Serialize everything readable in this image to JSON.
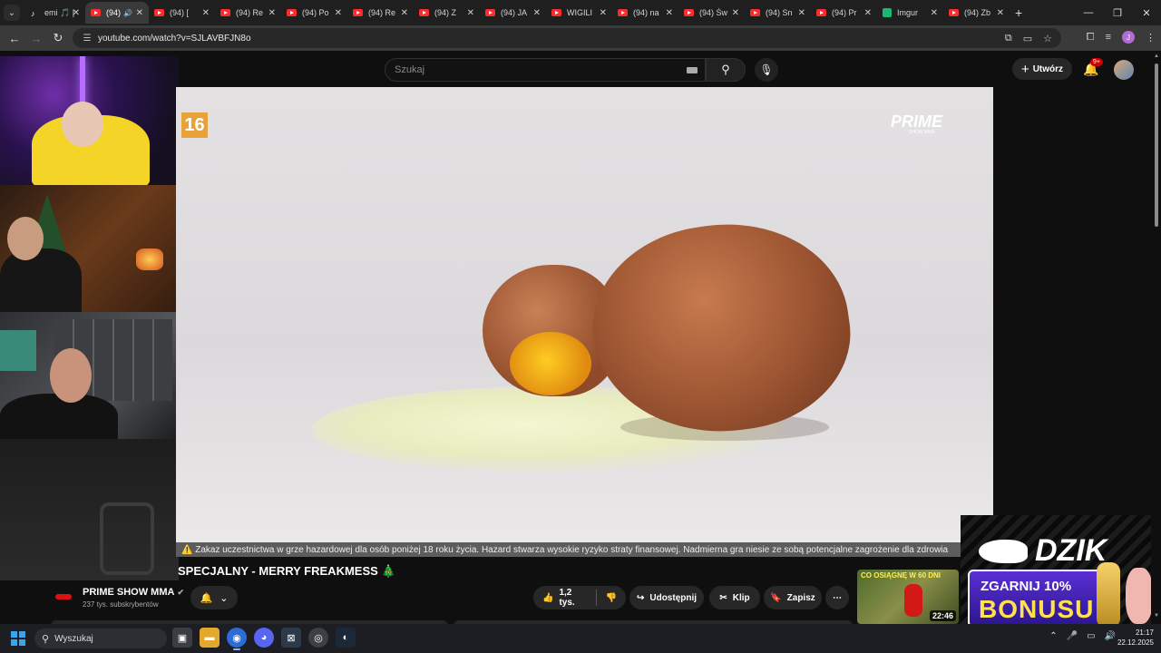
{
  "browser": {
    "tabs": [
      {
        "title": "emi 🎵 | ",
        "icon": "tiktok-icon",
        "active": false
      },
      {
        "title": "(94)",
        "icon": "youtube-icon",
        "active": true
      },
      {
        "title": "(94) [",
        "icon": "youtube-icon",
        "active": false
      },
      {
        "title": "(94) Re",
        "icon": "youtube-icon",
        "active": false
      },
      {
        "title": "(94) Po",
        "icon": "youtube-icon",
        "active": false
      },
      {
        "title": "(94) Re",
        "icon": "youtube-icon",
        "active": false
      },
      {
        "title": "(94) Z",
        "icon": "youtube-icon",
        "active": false
      },
      {
        "title": "(94) JA",
        "icon": "youtube-icon",
        "active": false
      },
      {
        "title": "WIGILI",
        "icon": "youtube-icon",
        "active": false
      },
      {
        "title": "(94) na",
        "icon": "youtube-icon",
        "active": false
      },
      {
        "title": "(94) Św",
        "icon": "youtube-icon",
        "active": false
      },
      {
        "title": "(94) Sn",
        "icon": "youtube-icon",
        "active": false
      },
      {
        "title": "(94) Pr",
        "icon": "youtube-icon",
        "active": false
      },
      {
        "title": "Imgur",
        "icon": "imgur-icon",
        "active": false
      },
      {
        "title": "(94) Zb",
        "icon": "youtube-icon",
        "active": false
      }
    ],
    "url": "youtube.com/watch?v=SJLAVBFJN8o"
  },
  "youtube": {
    "search_placeholder": "Szukaj",
    "create_label": "Utwórz",
    "notif_count": "9+",
    "video_title": "SPECJALNY - MERRY FREAKMESS 🎄",
    "channel_name": "PRIME SHOW MMA",
    "subscribers": "237 tys. subskrybentów",
    "likes": "1,2 tys.",
    "share_label": "Udostępnij",
    "clip_label": "Klip",
    "save_label": "Zapisz"
  },
  "video": {
    "age_rating": "16",
    "brand": "PRIME",
    "brand_sub": "SHOW MMA",
    "warning": "⚠️ Zakaz uczestnictwa w grze hazardowej dla osób poniżej 18 roku życia. Hazard stwarza wysokie ryzyko straty finansowej. Nadmierna gra niesie ze sobą potencjalne zagrożenie dla zdrowia"
  },
  "sponsor": {
    "brand": "DZIK",
    "bonus_top": "ZGARNIJ 10%",
    "bonus_main": "BONUSU"
  },
  "recommended": {
    "thumb_title": "CO OSIĄGNĘ W 60 DNI",
    "duration": "22:46"
  },
  "taskbar": {
    "search_placeholder": "Wyszukaj",
    "time": "21:17",
    "date": "22.12.2025"
  },
  "colors": {
    "yt_bg": "#0f0f0f",
    "yt_red": "#ff0000",
    "age_badge": "#e8a23b",
    "bonus_purple": "#4a24c4"
  }
}
